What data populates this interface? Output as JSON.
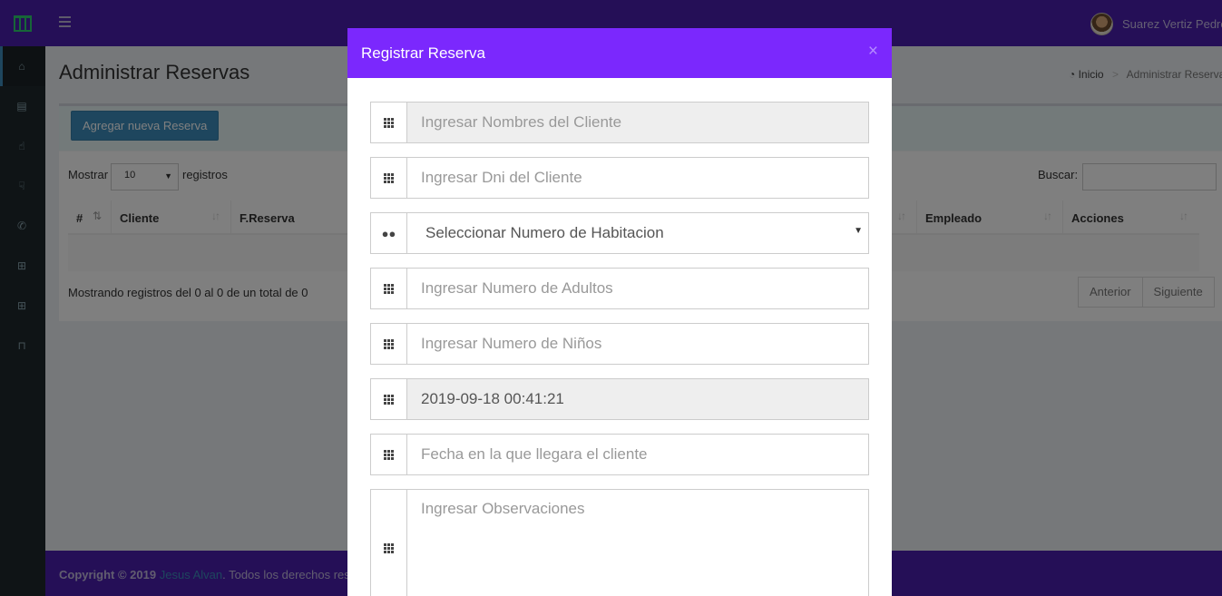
{
  "header": {
    "user_name": "Suarez Vertiz Pedro"
  },
  "sidebar": {
    "items": [
      "home-icon",
      "book-icon",
      "thumbs-up-icon",
      "thumbs-down-icon",
      "phone-icon",
      "cart-icon",
      "cart-icon",
      "bookmark-icon"
    ]
  },
  "page": {
    "title": "Administrar Reservas",
    "breadcrumb_home": "Inicio",
    "breadcrumb_current": "Administrar Reservas"
  },
  "box": {
    "add_button": "Agregar nueva Reserva",
    "show_label": "Mostrar",
    "show_value": "10",
    "records_label": "registros",
    "search_label": "Buscar:",
    "columns": [
      "#",
      "Cliente",
      "F.Reserva",
      "Empleado",
      "Acciones"
    ],
    "info": "Mostrando registros del 0 al 0 de un total de 0",
    "prev": "Anterior",
    "next": "Siguiente"
  },
  "footer": {
    "copyright": "Copyright © 2019",
    "author": "Jesus Alvan",
    "rights": ". Todos los derechos res"
  },
  "modal": {
    "title": "Registrar Reserva",
    "close": "×",
    "fields": {
      "client_names": "Ingresar Nombres del Cliente",
      "client_dni": "Ingresar Dni del Cliente",
      "room_number": "Seleccionar Numero de Habitacion",
      "adults": "Ingresar Numero de Adultos",
      "children": "Ingresar Numero de Niños",
      "reservation_date": "2019-09-18 00:41:21",
      "arrival_date": "Fecha en la que llegara el cliente",
      "observations": "Ingresar Observaciones"
    }
  }
}
